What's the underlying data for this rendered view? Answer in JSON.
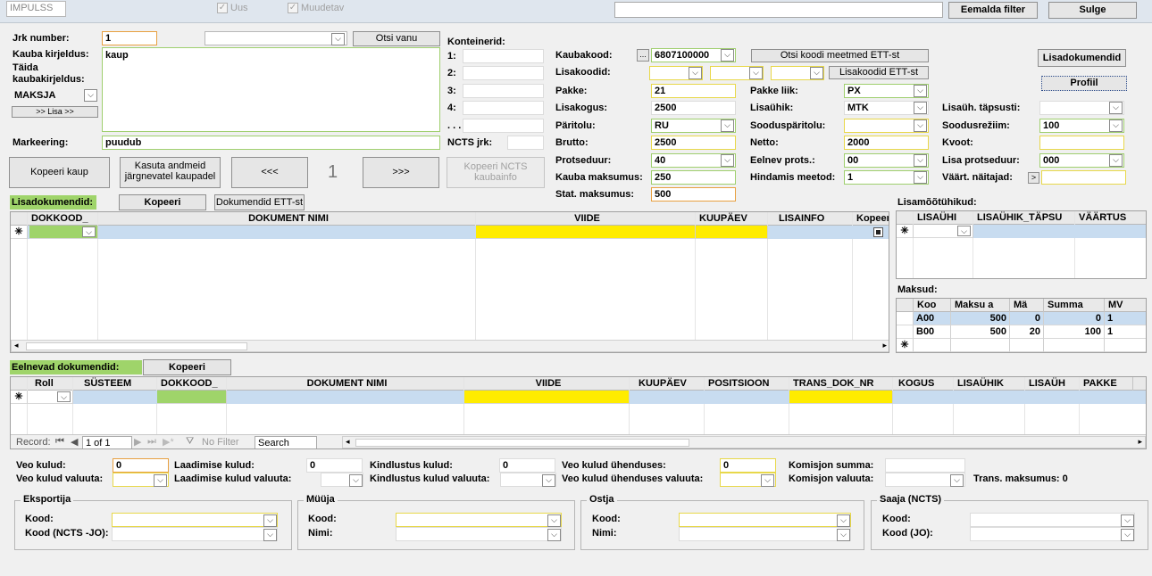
{
  "topbar": {
    "impulss": "IMPULSS",
    "uus": "Uus",
    "muudetav": "Muudetav",
    "filter_value": "",
    "remove_filter": "Eemalda filter",
    "close": "Sulge"
  },
  "item": {
    "jrk_label": "Jrk number:",
    "jrk_value": "1",
    "search_old": "Otsi vanu",
    "desc_label": "Kauba kirjeldus:",
    "desc_value": "kaup",
    "fill_label_1": "Täida",
    "fill_label_2": "kaubakirjeldus:",
    "maksja": "MAKSJA",
    "add_button": ">> Lisa >>",
    "marking_label": "Markeering:",
    "marking_value": "puudub",
    "copy_item": "Kopeeri kaup",
    "use_data_1": "Kasuta andmeid",
    "use_data_2": "järgnevatel kaupadel",
    "prev": "<<<",
    "current_index": "1",
    "next": ">>>",
    "copy_ncts_1": "Kopeeri NCTS",
    "copy_ncts_2": "kaubainfo"
  },
  "containers": {
    "title": "Konteinerid:",
    "labels": [
      "1:",
      "2:",
      "3:",
      "4:",
      ". . ."
    ],
    "ncts_label": "NCTS jrk:"
  },
  "goods": {
    "kaubakood_label": "Kaubakood:",
    "kaubakood_btn": "...",
    "kaubakood_value": "6807100000",
    "search_code_btn": "Otsi koodi meetmed ETT-st",
    "lisakoodid_label": "Lisakoodid:",
    "lisakoodid_btn": "Lisakoodid ETT-st",
    "pakke_label": "Pakke:",
    "pakke_value": "21",
    "pakke_liik_label": "Pakke liik:",
    "pakke_liik_value": "PX",
    "lisakogus_label": "Lisakogus:",
    "lisakogus_value": "2500",
    "lisauhik_label": "Lisaühik:",
    "lisauhik_value": "MTK",
    "paritolu_label": "Päritolu:",
    "paritolu_value": "RU",
    "sooduspar_label": "Sooduspäritolu:",
    "sooduspar_value": "",
    "brutto_label": "Brutto:",
    "brutto_value": "2500",
    "netto_label": "Netto:",
    "netto_value": "2000",
    "protseduur_label": "Protseduur:",
    "protseduur_value": "40",
    "eelnev_label": "Eelnev prots.:",
    "eelnev_value": "00",
    "kauba_maks_label": "Kauba maksumus:",
    "kauba_maks_value": "250",
    "hindamis_label": "Hindamis meetod:",
    "hindamis_value": "1",
    "stat_maks_label": "Stat. maksumus:",
    "stat_maks_value": "500"
  },
  "right": {
    "lisadok_btn": "Lisadokumendid",
    "profiil_btn": "Profiil",
    "lisauh_tapsusti_label": "Lisaüh. täpsusti:",
    "soodusreziim_label": "Soodusrežiim:",
    "soodusreziim_value": "100",
    "kvoot_label": "Kvoot:",
    "lisa_prots_label": "Lisa protseduur:",
    "lisa_prots_value": "000",
    "vaart_label": "Väärt. näitajad:",
    "vaart_btn": ">"
  },
  "lisadok": {
    "title": "Lisadokumendid:",
    "copy": "Kopeeri",
    "ett_btn": "Dokumendid ETT-st",
    "columns": [
      "DOKKOOD_",
      "DOKUMENT NIMI",
      "VIIDE",
      "KUUPÄEV",
      "LISAINFO",
      "Kopeer"
    ]
  },
  "lisamoot": {
    "title": "Lisamõõtühikud:",
    "columns": [
      "LISAÜHI",
      "LISAÜHIK_TÄPSU",
      "VÄÄRTUS"
    ]
  },
  "maksud": {
    "title": "Maksud:",
    "columns": [
      "Koo",
      "Maksu a",
      "Mä",
      "Summa",
      "MV"
    ],
    "rows": [
      [
        "A00",
        "500",
        "0",
        "0",
        "1"
      ],
      [
        "B00",
        "500",
        "20",
        "100",
        "1"
      ]
    ]
  },
  "eelnevad": {
    "title": "Eelnevad dokumendid:",
    "copy": "Kopeeri",
    "columns": [
      "Roll",
      "SÜSTEEM",
      "DOKKOOD_",
      "DOKUMENT NIMI",
      "VIIDE",
      "KUUPÄEV",
      "POSITSIOON",
      "TRANS_DOK_NR",
      "KOGUS",
      "LISAÜHIK",
      "LISAÜH",
      "PAKKE"
    ],
    "nav": {
      "record_label": "Record:",
      "position": "1 of 1",
      "no_filter": "No Filter",
      "search": "Search"
    }
  },
  "costs": {
    "veo_label": "Veo kulud:",
    "veo_value": "0",
    "veo_val_label": "Veo kulud valuuta:",
    "laad_label": "Laadimise kulud:",
    "laad_value": "0",
    "laad_val_label": "Laadimise kulud valuuta:",
    "kindl_label": "Kindlustus kulud:",
    "kindl_value": "0",
    "kindl_val_label": "Kindlustus kulud valuuta:",
    "veo_uh_label": "Veo kulud ühenduses:",
    "veo_uh_value": "0",
    "veo_uh_val_label": "Veo kulud ühenduses valuuta:",
    "kom_sum_label": "Komisjon summa:",
    "kom_val_label": "Komisjon valuuta:",
    "trans_label": "Trans. maksumus: 0"
  },
  "parties": [
    {
      "title": "Eksportija",
      "l1": "Kood:",
      "l2": "Kood (NCTS -JO):"
    },
    {
      "title": "Müüja",
      "l1": "Kood:",
      "l2": "Nimi:"
    },
    {
      "title": "Ostja",
      "l1": "Kood:",
      "l2": "Nimi:"
    },
    {
      "title": "Saaja (NCTS)",
      "l1": "Kood:",
      "l2": "Kood (JO):"
    }
  ]
}
